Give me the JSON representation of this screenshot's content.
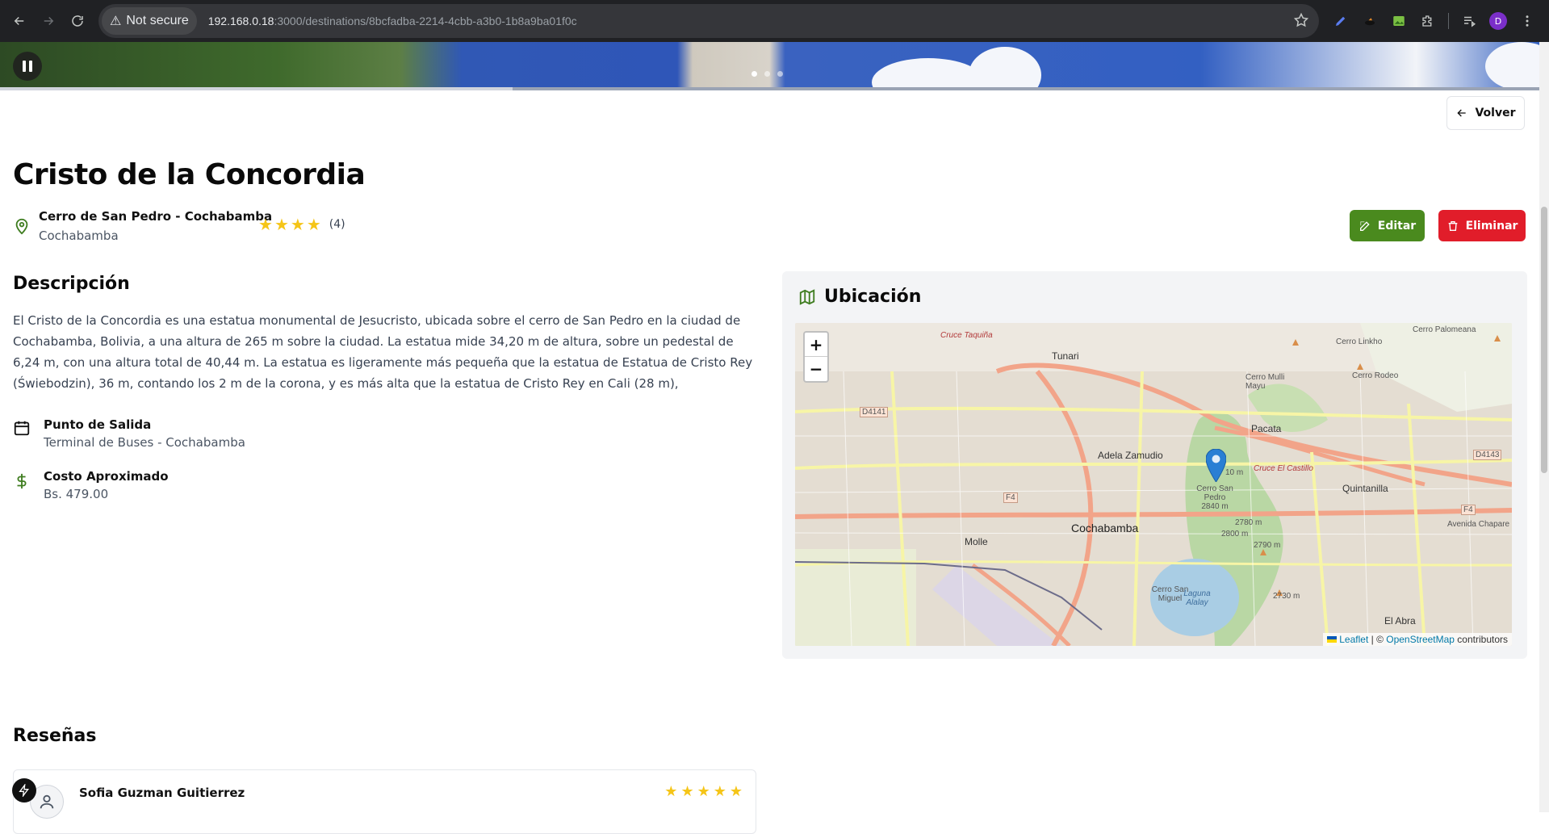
{
  "browser": {
    "security_label": "Not secure",
    "url_host": "192.168.0.18",
    "url_path": ":3000/destinations/8bcfadba-2214-4cbb-a3b0-1b8a9ba01f0c",
    "profile_initial": "D"
  },
  "header": {
    "back_label": "Volver"
  },
  "destination": {
    "title": "Cristo de la Concordia",
    "location_name": "Cerro de San Pedro - Cochabamba",
    "city": "Cochabamba",
    "rating_stars": 4,
    "rating_count": "(4)"
  },
  "actions": {
    "edit_label": "Editar",
    "delete_label": "Eliminar"
  },
  "description": {
    "heading": "Descripción",
    "text": "El Cristo de la Concordia es una estatua monumental de Jesucristo, ubicada sobre el cerro de San Pedro en la ciudad de Cochabamba, Bolivia, a una altura de 265 m sobre la ciudad. La estatua mide 34,20 m de altura, sobre un pedestal de 6,24 m, con una altura total de 40,44 m. La estatua es ligeramente más pequeña que la estatua de Estatua de Cristo Rey (Świebodzin), 36 m, contando los 2 m de la corona, y es más alta que la estatua de Cristo Rey en Cali (28 m),"
  },
  "details": {
    "departure_label": "Punto de Salida",
    "departure_value": "Terminal de Buses - Cochabamba",
    "cost_label": "Costo Aproximado",
    "cost_value": "Bs. 479.00"
  },
  "map": {
    "heading": "Ubicación",
    "zoom_in": "+",
    "zoom_out": "−",
    "attribution_leaflet": "Leaflet",
    "attribution_sep": " | © ",
    "attribution_osm": "OpenStreetMap",
    "attribution_tail": " contributors",
    "labels": {
      "cochabamba": "Cochabamba",
      "tunari": "Tunari",
      "adela": "Adela Zamudio",
      "pacata": "Pacata",
      "quintanilla": "Quintanilla",
      "molle": "Molle",
      "el_abra": "El Abra",
      "cerro_linkho": "Cerro Linkho",
      "cerro_palomeana": "Cerro Palomeana",
      "cerro_mulli": "Cerro Mulli Mayu",
      "cerro_rodeo": "Cerro Rodeo",
      "cerro_san_pedro": "Cerro San Pedro 2840 m",
      "cerro_san_miguel": "Cerro San Miguel",
      "laguna": "Laguna Alalay",
      "cruce_taquina": "Cruce Taquiña",
      "cruce_castillo": "Cruce El Castillo",
      "avenida_chapare": "Avenida Chapare",
      "d4141": "D4141",
      "d4143": "D4143",
      "f4a": "F4",
      "f4b": "F4",
      "e2780": "2780 m",
      "e2800": "2800 m",
      "e2790": "2790 m",
      "e2730": "2730 m",
      "e10": "10 m"
    }
  },
  "reviews": {
    "heading": "Reseñas",
    "items": [
      {
        "author": "Sofia Guzman Guitierrez",
        "stars": 5
      }
    ]
  },
  "colors": {
    "brand_green": "#4a8a1e",
    "danger_red": "#e11d2a",
    "star_yellow": "#f5c518"
  }
}
